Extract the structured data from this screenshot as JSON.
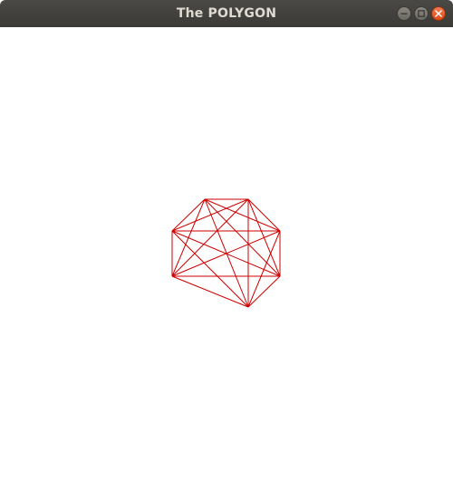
{
  "window": {
    "title": "The POLYGON"
  },
  "titlebar": {
    "buttons": [
      {
        "name": "minimize-button",
        "icon": "minimize-icon"
      },
      {
        "name": "maximize-button",
        "icon": "maximize-icon"
      },
      {
        "name": "close-button",
        "icon": "close-icon"
      }
    ],
    "close_color": "#e95420"
  },
  "drawing": {
    "stroke_color": "#cc0000",
    "vertex_count": 7,
    "all_diagonals_drawn": true
  }
}
